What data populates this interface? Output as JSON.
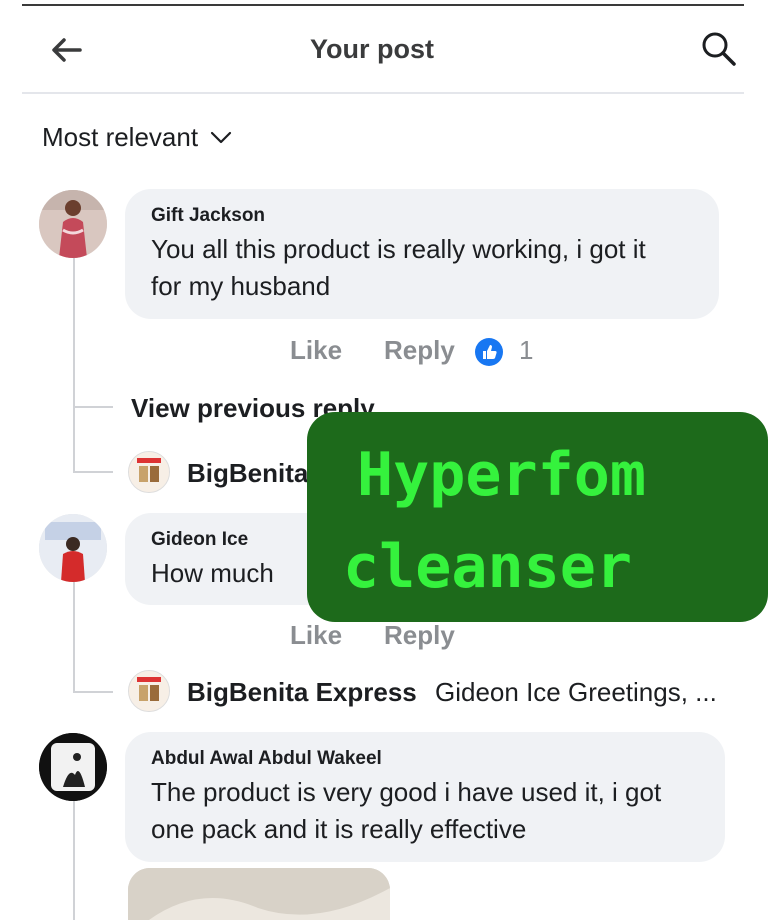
{
  "header": {
    "title": "Your post"
  },
  "sort": {
    "label": "Most relevant"
  },
  "comments": [
    {
      "author": "Gift Jackson",
      "text_line1": "You all this product is really working, i got it",
      "text_line2": "for my husband",
      "like_label": "Like",
      "reply_label": "Reply",
      "reaction_count": "1"
    },
    {
      "author": "Gideon Ice",
      "text": "How much",
      "like_label": "Like",
      "reply_label": "Reply"
    },
    {
      "author": "Abdul Awal Abdul Wakeel",
      "text_line1": "The product is very good i have used it, i got",
      "text_line2": "one pack and it is really effective"
    }
  ],
  "view_previous_reply": "View previous reply",
  "replies": [
    {
      "author": "BigBenita Express",
      "text": ""
    },
    {
      "author": "BigBenita Express",
      "text": "Gideon Ice Greetings, ..."
    }
  ],
  "overlay": {
    "line1": "Hyperfom",
    "line2": "cleanser"
  },
  "colors": {
    "overlay_bg": "#1d6a1b",
    "overlay_text": "#35f23d",
    "bubble_bg": "#f0f2f5",
    "like_blue": "#1877f2",
    "muted": "#8a8d91"
  },
  "icons": [
    "back-arrow-icon",
    "search-icon",
    "chevron-down-icon",
    "like-reaction-icon"
  ]
}
